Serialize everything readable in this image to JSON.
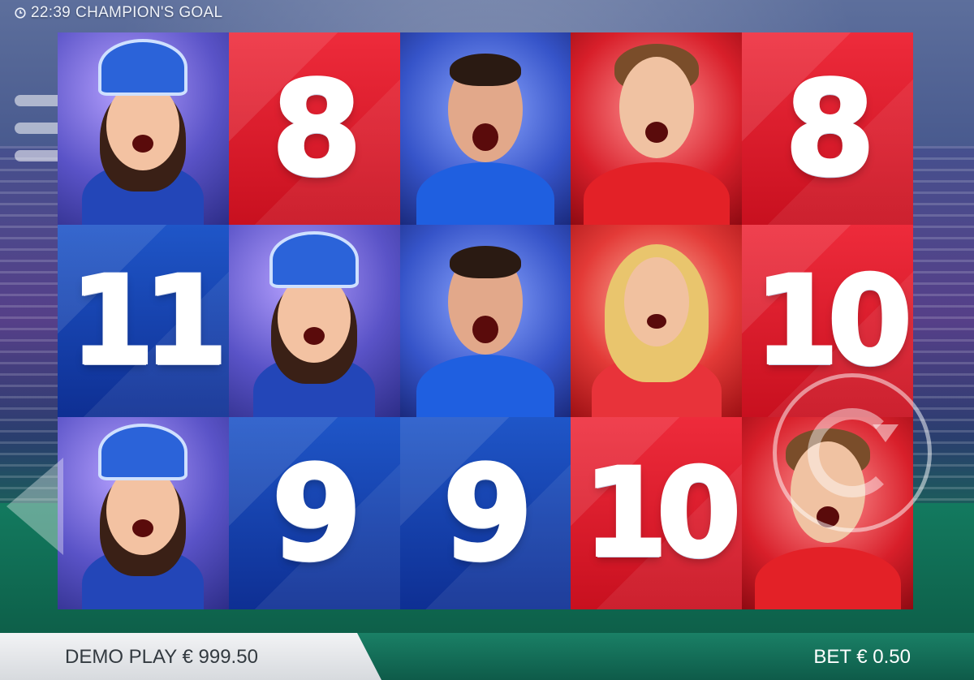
{
  "header": {
    "time": "22:39",
    "game_title": "CHAMPION'S GOAL"
  },
  "reels": [
    [
      {
        "symbol": "fan-jester-girl",
        "label": ""
      },
      {
        "symbol": "number-8",
        "label": "8"
      },
      {
        "symbol": "blue-player",
        "label": ""
      },
      {
        "symbol": "red-player",
        "label": ""
      },
      {
        "symbol": "number-8",
        "label": "8"
      }
    ],
    [
      {
        "symbol": "number-11",
        "label": "11"
      },
      {
        "symbol": "fan-jester-girl",
        "label": ""
      },
      {
        "symbol": "blue-player",
        "label": ""
      },
      {
        "symbol": "cheerleader",
        "label": ""
      },
      {
        "symbol": "number-10",
        "label": "10"
      }
    ],
    [
      {
        "symbol": "fan-jester-girl",
        "label": ""
      },
      {
        "symbol": "number-9",
        "label": "9"
      },
      {
        "symbol": "number-9",
        "label": "9"
      },
      {
        "symbol": "number-10",
        "label": "10"
      },
      {
        "symbol": "red-player",
        "label": ""
      }
    ]
  ],
  "labels": {
    "r0c1": "8",
    "r0c4": "8",
    "r1c0": "11",
    "r1c4": "10",
    "r2c1": "9",
    "r2c2": "9",
    "r2c3": "10"
  },
  "footer": {
    "balance": "DEMO PLAY € 999.50",
    "bet": "BET € 0.50"
  },
  "icons": {
    "menu": "hamburger-menu-icon",
    "spin": "spin-icon",
    "clock": "clock-icon",
    "autoplay": "left-arrow-icon"
  },
  "colors": {
    "red_tile": "#e42230",
    "blue_tile": "#1a47b6",
    "footer_green": "#137a5f"
  }
}
